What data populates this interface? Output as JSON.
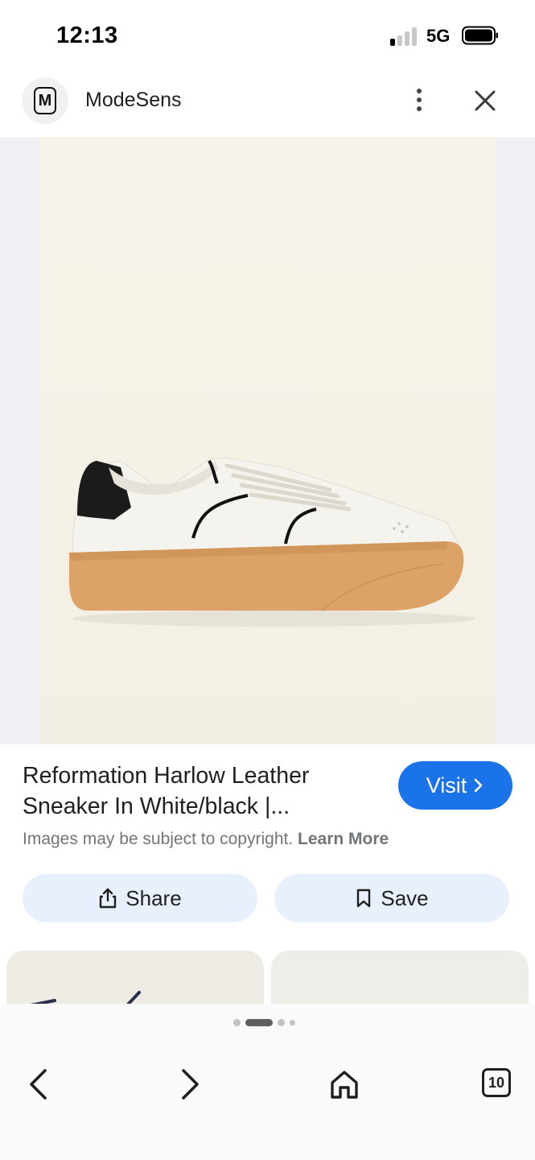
{
  "status_bar": {
    "time": "12:13",
    "network": "5G",
    "signal_bars_active": 1,
    "signal_bars_total": 4
  },
  "header": {
    "logo_letter": "M",
    "site_name": "ModeSens",
    "menu_icon": "more-vert-icon",
    "close_icon": "close-icon"
  },
  "result": {
    "title": "Reformation Harlow Leather Sneaker In White/black |...",
    "visit_label": "Visit",
    "copyright_text": "Images may be subject to copyright.",
    "learn_more": "Learn More",
    "share_label": "Share",
    "save_label": "Save"
  },
  "pager": {
    "active_index": 1,
    "count": 4
  },
  "bottom_nav": {
    "back_icon": "chevron-left-icon",
    "forward_icon": "chevron-right-icon",
    "home_icon": "home-icon",
    "tabs_count": "10"
  },
  "colors": {
    "accent": "#1a73e8",
    "button_bg": "#e8f0fe",
    "sole": "#dca266"
  }
}
